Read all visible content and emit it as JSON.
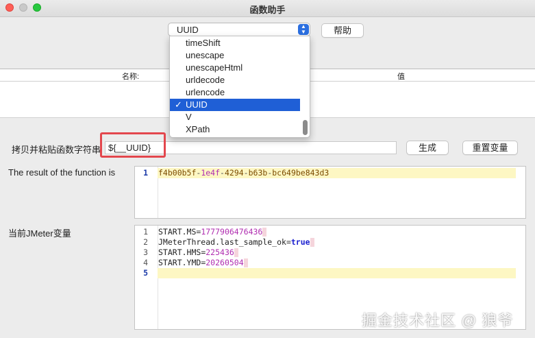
{
  "window": {
    "title": "函数助手"
  },
  "function_select": {
    "value": "UUID"
  },
  "help_button": "帮助",
  "params_table": {
    "headers": [
      "名称:",
      "值"
    ]
  },
  "dropdown": {
    "items": [
      "timeShift",
      "unescape",
      "unescapeHtml",
      "urldecode",
      "urlencode",
      "UUID",
      "V",
      "XPath"
    ],
    "selected": "UUID",
    "check": "✓"
  },
  "copy_paste": {
    "label": "拷贝并粘贴函数字符串",
    "value": "${__UUID}"
  },
  "generate_button": "生成",
  "reset_button": "重置变量",
  "result": {
    "label": "The result of the function is",
    "line_numbers": [
      "1"
    ],
    "value_parts": [
      "f4b00b5f",
      "-",
      "1e4f",
      "-",
      "4294",
      "-",
      "b63b",
      "-",
      "bc649be843d3"
    ]
  },
  "vars": {
    "label": "当前JMeter变量",
    "line_numbers": [
      "1",
      "2",
      "3",
      "4",
      "5"
    ],
    "lines": [
      {
        "key": "START.MS",
        "eq": "=",
        "value": "1777906476436"
      },
      {
        "key": "JMeterThread.last_sample_ok",
        "eq": "=",
        "value": "true"
      },
      {
        "key": "START.HMS",
        "eq": "=",
        "value": "225436"
      },
      {
        "key": "START.YMD",
        "eq": "=",
        "value": "20260504"
      }
    ]
  },
  "watermark": "掘金技术社区 @ 狼爷"
}
